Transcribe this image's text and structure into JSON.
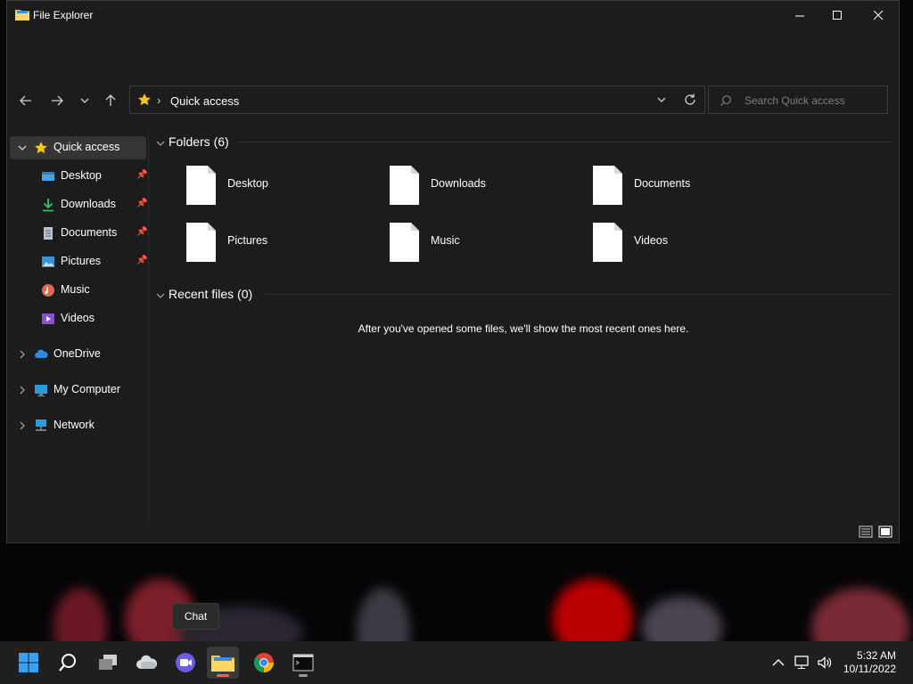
{
  "window": {
    "title": "File Explorer",
    "controls": {
      "minimize": "minimize",
      "maximize": "maximize",
      "close": "close"
    }
  },
  "toolbar": {
    "back_icon": "arrow-left-icon",
    "forward_icon": "arrow-right-icon",
    "recent_icon": "chevron-down-icon",
    "up_icon": "arrow-up-icon"
  },
  "address": {
    "location_icon": "star-icon",
    "separator": "›",
    "crumb": "Quick access"
  },
  "search": {
    "placeholder": "Search Quick access",
    "value": ""
  },
  "sidebar": {
    "items": [
      {
        "label": "Quick access",
        "icon": "star-icon",
        "expanded": true,
        "selected": true
      },
      {
        "label": "Desktop",
        "icon": "desktop-icon",
        "pinned": true
      },
      {
        "label": "Downloads",
        "icon": "download-icon",
        "pinned": true
      },
      {
        "label": "Documents",
        "icon": "document-icon",
        "pinned": true
      },
      {
        "label": "Pictures",
        "icon": "pictures-icon",
        "pinned": true
      },
      {
        "label": "Music",
        "icon": "music-icon"
      },
      {
        "label": "Videos",
        "icon": "videos-icon"
      },
      {
        "label": "OneDrive",
        "icon": "cloud-icon",
        "expanded": false
      },
      {
        "label": "My Computer",
        "icon": "computer-icon",
        "expanded": false
      },
      {
        "label": "Network",
        "icon": "network-icon",
        "expanded": false
      }
    ]
  },
  "main": {
    "folders_header": "Folders (6)",
    "folders": [
      {
        "label": "Desktop"
      },
      {
        "label": "Downloads"
      },
      {
        "label": "Documents"
      },
      {
        "label": "Pictures"
      },
      {
        "label": "Music"
      },
      {
        "label": "Videos"
      }
    ],
    "recent_header": "Recent files (0)",
    "recent_empty_message": "After you've opened some files, we'll show the most recent ones here."
  },
  "statusbar": {
    "details_view_icon": "details-view-icon",
    "tiles_view_icon": "tiles-view-icon"
  },
  "taskbar": {
    "apps": [
      {
        "name": "start",
        "icon": "windows-start-icon"
      },
      {
        "name": "search",
        "icon": "search-icon"
      },
      {
        "name": "task-view",
        "icon": "task-view-icon"
      },
      {
        "name": "widgets",
        "icon": "weather-widget-icon"
      },
      {
        "name": "chat",
        "icon": "chat-icon"
      },
      {
        "name": "file-explorer",
        "icon": "folder-icon",
        "active": true
      },
      {
        "name": "chrome",
        "icon": "chrome-icon"
      },
      {
        "name": "terminal",
        "icon": "terminal-icon",
        "running": true
      }
    ],
    "tooltip": "Chat",
    "tray": {
      "overflow_icon": "chevron-up-icon",
      "network_icon": "network-tray-icon",
      "volume_icon": "volume-icon"
    },
    "clock": {
      "time": "5:32 AM",
      "date": "10/11/2022"
    }
  }
}
